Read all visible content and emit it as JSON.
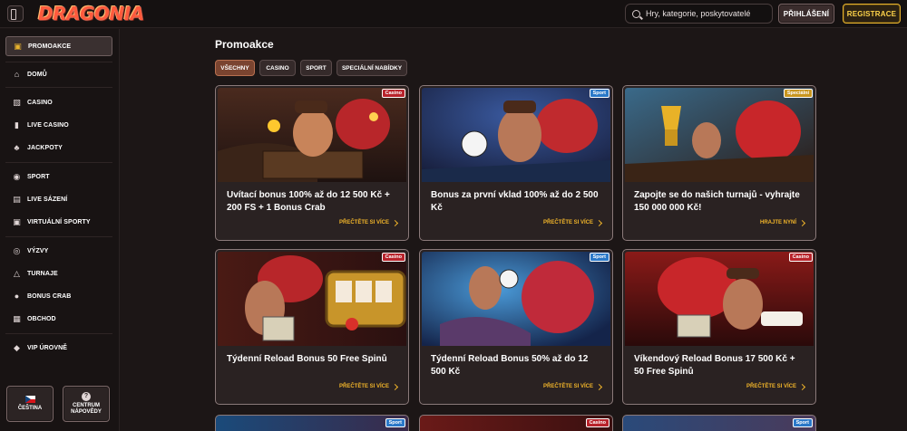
{
  "header": {
    "logo_text": "DRAGONIA",
    "search_placeholder": "Hry, kategorie, poskytovatelé",
    "login_label": "PŘIHLÁŠENÍ",
    "register_label": "REGISTRACE"
  },
  "sidebar": {
    "items": [
      {
        "label": "PROMOAKCE",
        "icon": "gift-icon"
      },
      {
        "label": "DOMŮ",
        "icon": "home-icon"
      },
      {
        "label": "CASINO",
        "icon": "slot-icon"
      },
      {
        "label": "LIVE CASINO",
        "icon": "cards-icon"
      },
      {
        "label": "JACKPOTY",
        "icon": "clover-icon"
      },
      {
        "label": "SPORT",
        "icon": "ball-icon"
      },
      {
        "label": "LIVE SÁZENÍ",
        "icon": "live-icon"
      },
      {
        "label": "VIRTUÁLNÍ SPORTY",
        "icon": "virtual-icon"
      },
      {
        "label": "VÝZVY",
        "icon": "challenge-icon"
      },
      {
        "label": "TURNAJE",
        "icon": "trophy-icon"
      },
      {
        "label": "BONUS CRAB",
        "icon": "crab-icon"
      },
      {
        "label": "OBCHOD",
        "icon": "shop-icon"
      },
      {
        "label": "VIP ÚROVNĚ",
        "icon": "diamond-icon"
      }
    ],
    "language_label": "ČEŠTINA",
    "help_label_1": "CENTRUM",
    "help_label_2": "NÁPOVĚDY"
  },
  "main": {
    "title": "Promoakce",
    "filters": [
      "VŠECHNY",
      "CASINO",
      "SPORT",
      "SPECIÁLNÍ NABÍDKY"
    ],
    "active_filter": "VŠECHNY",
    "cards": [
      {
        "badge": "Casino",
        "title": "Uvítací bonus 100% až do 12 500 Kč + 200 FS + 1 Bonus Crab",
        "link": "PŘEČTĚTE SI VÍCE"
      },
      {
        "badge": "Sport",
        "title": "Bonus za první vklad 100% až do 2 500 Kč",
        "link": "PŘEČTĚTE SI VÍCE"
      },
      {
        "badge": "Speciální",
        "title": "Zapojte se do našich turnajů - vyhrajte 150 000 000 Kč!",
        "link": "HRAJTE NYNÍ"
      },
      {
        "badge": "Casino",
        "title": "Týdenní Reload Bonus 50 Free Spinů",
        "link": "PŘEČTĚTE SI VÍCE"
      },
      {
        "badge": "Sport",
        "title": "Týdenní Reload Bonus 50% až do 12 500 Kč",
        "link": "PŘEČTĚTE SI VÍCE"
      },
      {
        "badge": "Casino",
        "title": "Víkendový Reload Bonus 17 500 Kč + 50 Free Spinů",
        "link": "PŘEČTĚTE SI VÍCE"
      }
    ],
    "bottom_badges": [
      "Sport",
      "Casino",
      "Sport"
    ]
  },
  "colors": {
    "accent_gold": "#f0b42a",
    "casino_badge": "#b8232b",
    "sport_badge": "#2a78c8",
    "special_badge": "#c8951e",
    "background": "#1c1616"
  }
}
